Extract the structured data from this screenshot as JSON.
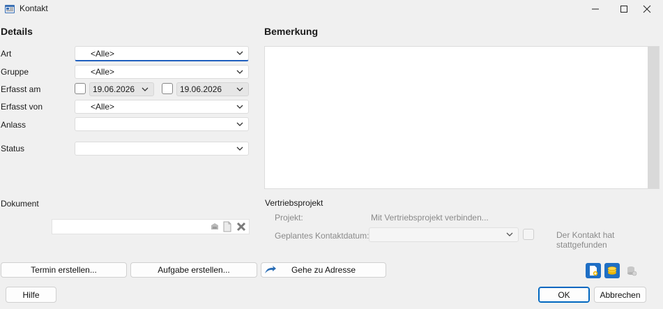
{
  "window": {
    "title": "Kontakt",
    "minimize_icon": "minimize-icon",
    "maximize_icon": "maximize-icon",
    "close_icon": "close-icon"
  },
  "details": {
    "heading": "Details",
    "fields": {
      "art": {
        "label": "Art",
        "value": "<Alle>"
      },
      "gruppe": {
        "label": "Gruppe",
        "value": "<Alle>"
      },
      "erfasst_am": {
        "label": "Erfasst am",
        "from": "19.06.2026",
        "to": "19.06.2026"
      },
      "erfasst_von": {
        "label": "Erfasst von",
        "value": "<Alle>"
      },
      "anlass": {
        "label": "Anlass",
        "value": ""
      },
      "status": {
        "label": "Status",
        "value": ""
      }
    },
    "dokument": {
      "label": "Dokument",
      "value": ""
    }
  },
  "bemerkung": {
    "heading": "Bemerkung",
    "text": ""
  },
  "vertriebsprojekt": {
    "heading": "Vertriebsprojekt",
    "projekt_label": "Projekt:",
    "projekt_link": "Mit Vertriebsprojekt verbinden...",
    "kontaktdatum_label": "Geplantes Kontaktdatum:",
    "kontaktdatum_value": "",
    "stattgefunden_label": "Der Kontakt hat stattgefunden"
  },
  "actions": {
    "termin": "Termin erstellen...",
    "aufgabe": "Aufgabe erstellen...",
    "adresse": "Gehe zu Adresse"
  },
  "footer": {
    "hilfe": "Hilfe",
    "ok": "OK",
    "abbrechen": "Abbrechen"
  },
  "colors": {
    "accent": "#0067c0",
    "focus_underline": "#1f5fbf"
  }
}
